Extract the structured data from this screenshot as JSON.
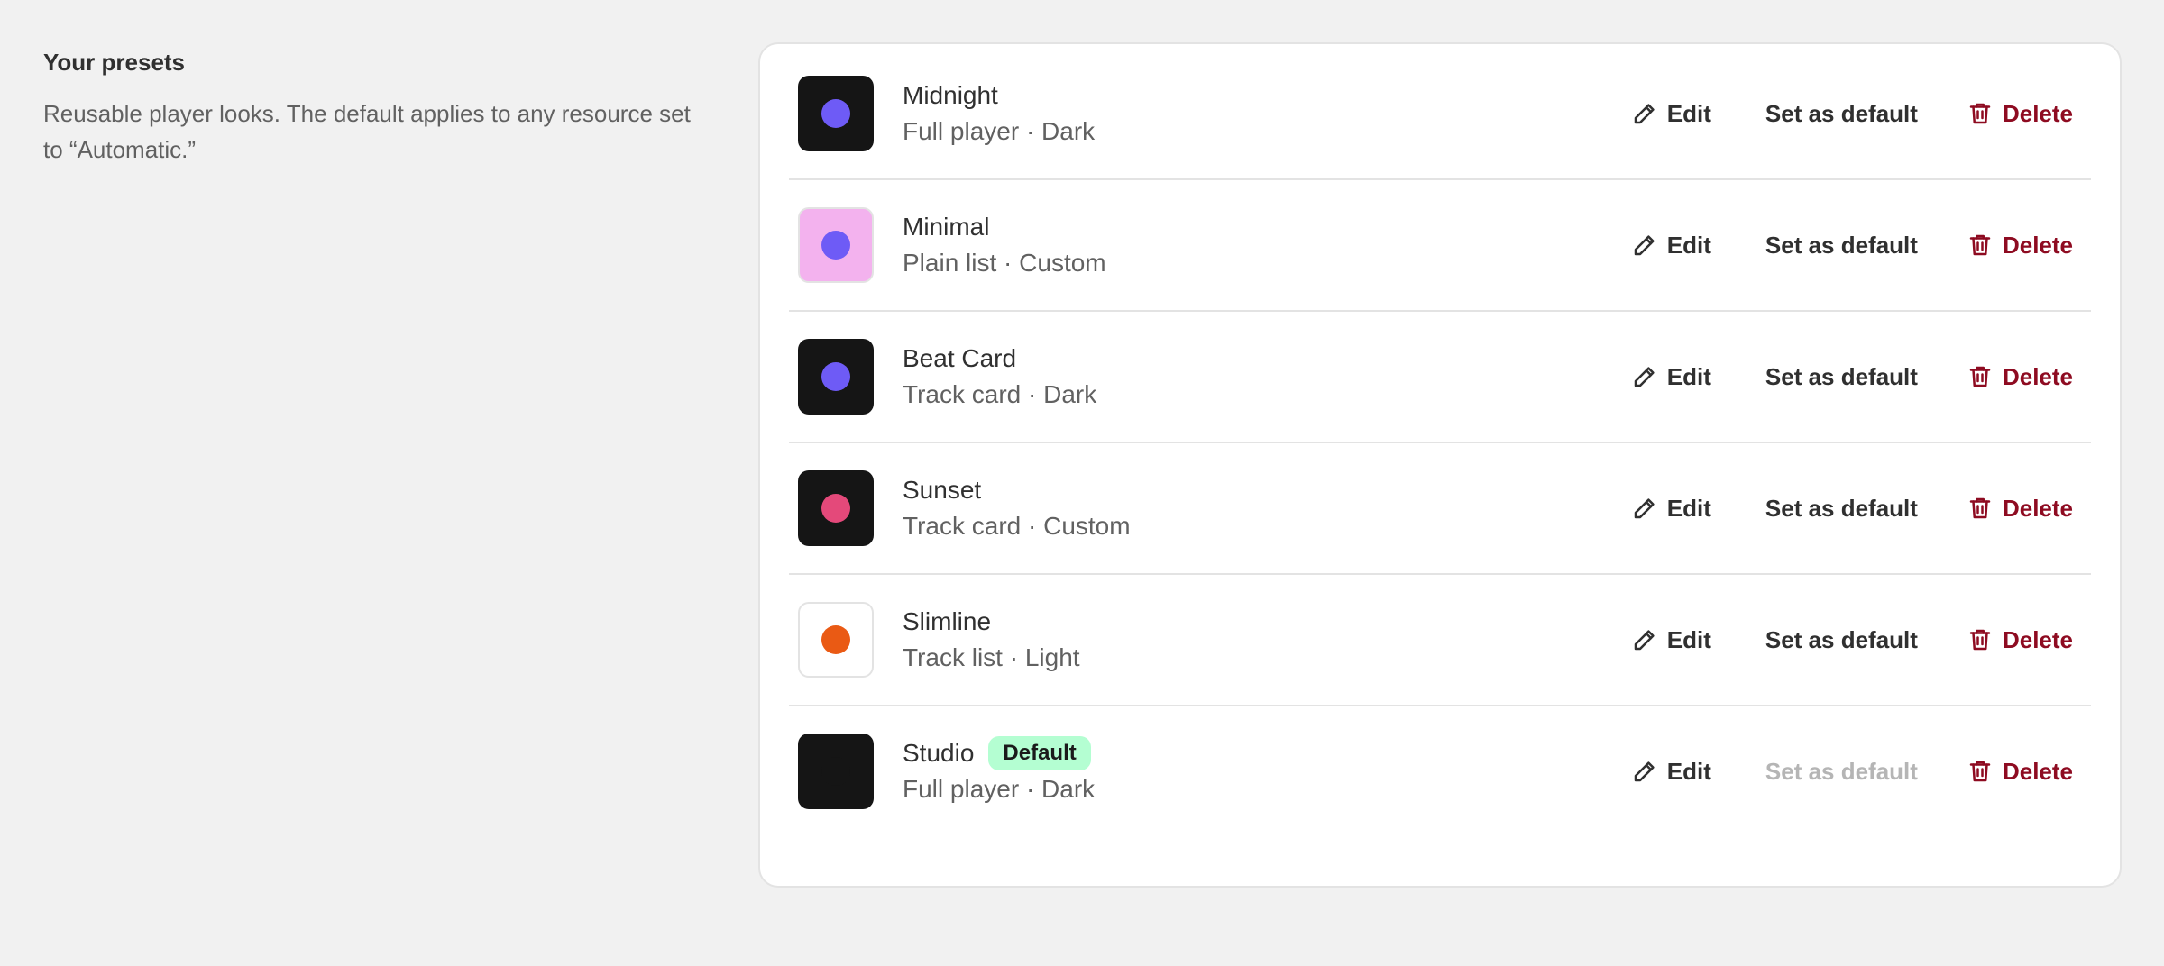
{
  "section": {
    "title": "Your presets",
    "description": "Reusable player looks. The default applies to any resource set to “Automatic.”"
  },
  "actions": {
    "edit_label": "Edit",
    "set_default_label": "Set as default",
    "delete_label": "Delete"
  },
  "colors": {
    "delete": "#8e0b21",
    "badge_bg": "#b4fed2",
    "disabled_text": "#b5b5b5"
  },
  "presets": [
    {
      "name": "Midnight",
      "meta": "Full player · Dark",
      "swatch_bg": "#151515",
      "dot_color": "#6e5bf6",
      "bordered": false,
      "is_default": false
    },
    {
      "name": "Minimal",
      "meta": "Plain list · Custom",
      "swatch_bg": "#f3b2ee",
      "dot_color": "#6e5bf6",
      "bordered": true,
      "is_default": false
    },
    {
      "name": "Beat Card",
      "meta": "Track card · Dark",
      "swatch_bg": "#151515",
      "dot_color": "#6e5bf6",
      "bordered": false,
      "is_default": false
    },
    {
      "name": "Sunset",
      "meta": "Track card · Custom",
      "swatch_bg": "#151515",
      "dot_color": "#e4497a",
      "bordered": false,
      "is_default": false
    },
    {
      "name": "Slimline",
      "meta": "Track list · Light",
      "swatch_bg": "#ffffff",
      "dot_color": "#ea5a14",
      "bordered": true,
      "is_default": false
    },
    {
      "name": "Studio",
      "meta": "Full player · Dark",
      "swatch_bg": "#151515",
      "dot_color": "#151515",
      "bordered": false,
      "is_default": true,
      "badge_label": "Default"
    }
  ]
}
